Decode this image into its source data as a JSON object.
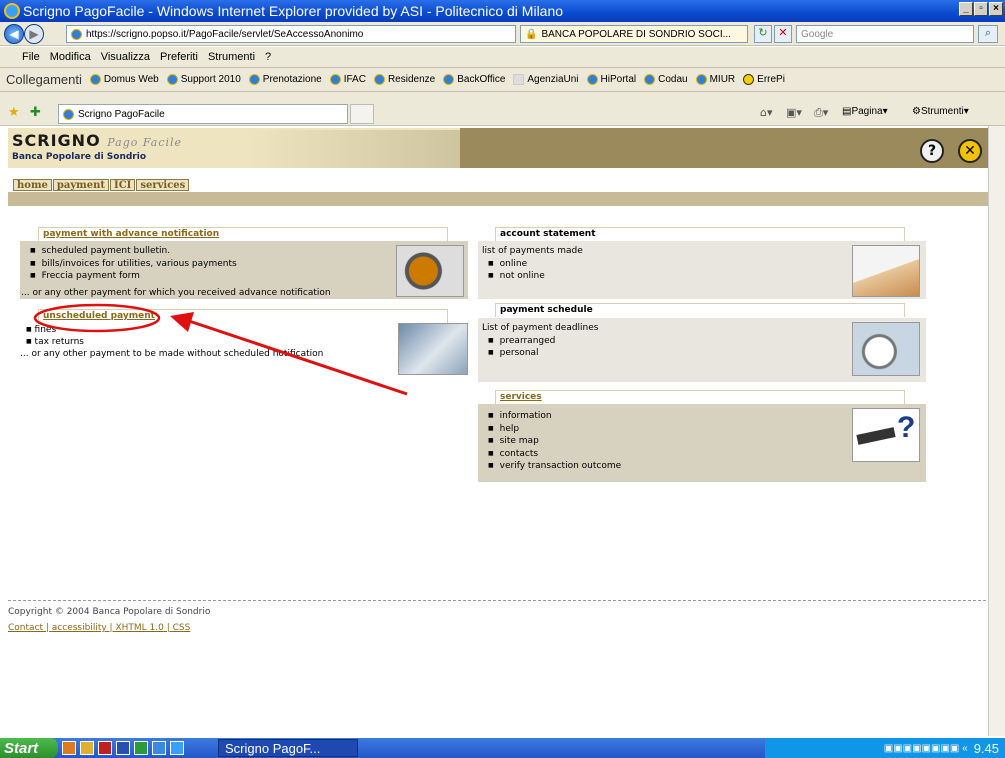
{
  "window": {
    "title": "Scrigno PagoFacile - Windows Internet Explorer provided by ASI - Politecnico di Milano"
  },
  "address": {
    "url": "https://scrigno.popso.it/PagoFacile/servlet/SeAccessoAnonimo",
    "cert": "BANCA POPOLARE DI SONDRIO SOCI...",
    "search_placeholder": "Google"
  },
  "menu": [
    "File",
    "Modifica",
    "Visualizza",
    "Preferiti",
    "Strumenti",
    "?"
  ],
  "links": {
    "label": "Collegamenti",
    "items": [
      "Domus Web",
      "Support 2010",
      "Prenotazione",
      "IFAC",
      "Residenze",
      "BackOffice",
      "AgenziaUni",
      "HiPortal",
      "Codau",
      "MIUR",
      "ErrePi"
    ]
  },
  "tab": {
    "title": "Scrigno PagoFacile",
    "tools_page": "Pagina",
    "tools_tools": "Strumenti"
  },
  "site": {
    "logo": "SCRIGNO",
    "logo_sub": "Pago Facile",
    "bank": "Banca Popolare di Sondrio",
    "help_icon": "?",
    "close_icon": "✕",
    "nav": [
      "home",
      "payment",
      "ICI",
      "services"
    ]
  },
  "advance": {
    "title": "payment with advance notification",
    "items": [
      "scheduled payment bulletin.",
      "bills/invoices for utilities, various payments",
      "Freccia payment form"
    ],
    "note": "... or any other payment for which you received advance notification"
  },
  "unscheduled": {
    "title": "unscheduled payment",
    "items": [
      "fines",
      "tax returns"
    ],
    "note": "... or any other payment to be made without scheduled notification"
  },
  "account": {
    "title": "account statement",
    "intro": "list of payments made",
    "items": [
      "online",
      "not online"
    ]
  },
  "schedule": {
    "title": "payment schedule",
    "intro": "List of payment deadlines",
    "items": [
      "prearranged",
      "personal"
    ]
  },
  "services": {
    "title": "services",
    "items": [
      "information",
      "help",
      "site map",
      "contacts",
      "verify transaction outcome"
    ]
  },
  "footer": {
    "copyright": "Copyright © 2004 Banca Popolare di Sondrio",
    "links": [
      "Contact",
      "accessibility",
      "XHTML 1.0",
      "CSS"
    ]
  },
  "taskbar": {
    "start": "Start",
    "item": "Scrigno PagoF...",
    "time": "9.45"
  },
  "colors": {
    "annotation": "#e01010",
    "title_bar": "#0a4ad0",
    "section_link": "#8a6a1a"
  }
}
